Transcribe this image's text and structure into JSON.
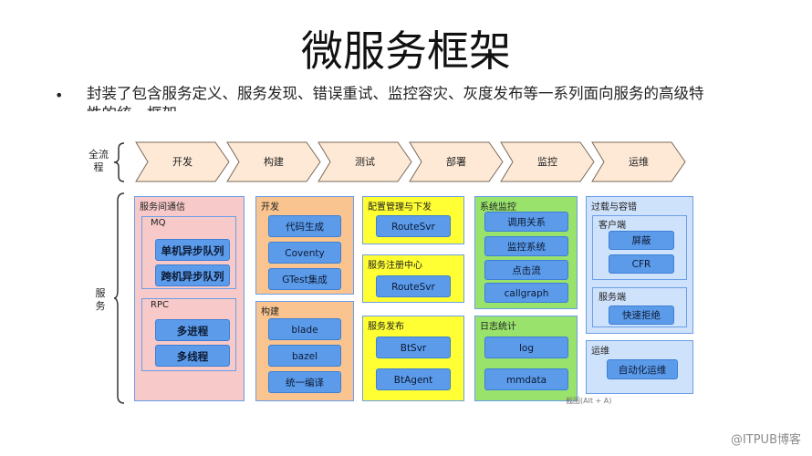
{
  "slide": {
    "title": "微服务框架",
    "bullet": "封装了包含服务定义、服务发现、错误重试、监控容灾、灰度发布等一系列面向服务的高级特性的统一框架"
  },
  "rows": {
    "pipeline_label": "全流\n程",
    "services_label": "服\n务"
  },
  "pipeline": [
    "开发",
    "构建",
    "测试",
    "部署",
    "监控",
    "运维"
  ],
  "groups": {
    "comm": {
      "label": "服务间通信",
      "mq": {
        "label": "MQ",
        "items": [
          "单机异步队列",
          "跨机异步队列"
        ]
      },
      "rpc": {
        "label": "RPC",
        "items": [
          "多进程",
          "多线程"
        ]
      }
    },
    "dev": {
      "label": "开发",
      "items": [
        "代码生成",
        "Coventy",
        "GTest集成"
      ]
    },
    "build": {
      "label": "构建",
      "items": [
        "blade",
        "bazel",
        "统一编译"
      ]
    },
    "config": {
      "label": "配置管理与下发",
      "items": [
        "RouteSvr"
      ]
    },
    "registry": {
      "label": "服务注册中心",
      "items": [
        "RouteSvr"
      ]
    },
    "publish": {
      "label": "服务发布",
      "items": [
        "BtSvr",
        "BtAgent"
      ]
    },
    "sysmon": {
      "label": "系统监控",
      "items": [
        "调用关系",
        "监控系统",
        "点击流",
        "callgraph"
      ]
    },
    "logstats": {
      "label": "日志统计",
      "items": [
        "log",
        "mmdata"
      ]
    },
    "overload": {
      "label": "过载与容错",
      "client": {
        "label": "客户端",
        "items": [
          "屏蔽",
          "CFR"
        ]
      },
      "server": {
        "label": "服务端",
        "items": [
          "快速拒绝"
        ]
      }
    },
    "ops": {
      "label": "运维",
      "items": [
        "自动化运维"
      ]
    }
  },
  "screenshot_hint": "截图(Alt + A)",
  "footer": "@ITPUB博客",
  "colors": {
    "chip": "#5b9bea",
    "comm_bg": "#f7c9c9",
    "devbuild_bg": "#f9c48f",
    "deploy_bg": "#ffff33",
    "monitor_bg": "#99e26b",
    "ops_bg": "#cfe2fb",
    "border_blue": "#6a9ee8"
  }
}
